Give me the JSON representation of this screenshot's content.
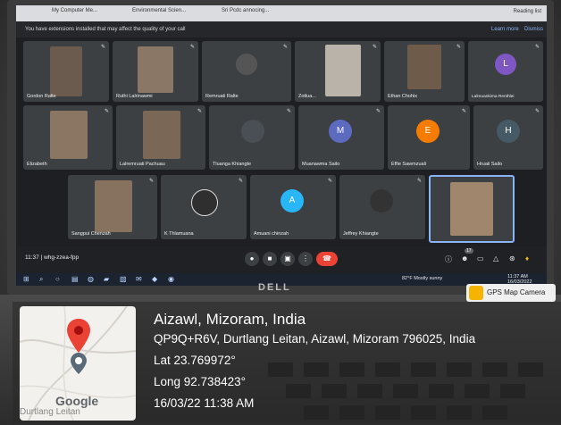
{
  "browser": {
    "tabs": [
      "My Computer Me...",
      "Environmental Scien...",
      "Sri Pcdc annocing..."
    ],
    "reading_list": "Reading list"
  },
  "banner": {
    "text": "You have extensions installed that may affect the quality of your call",
    "learn_more": "Learn more",
    "dismiss": "Dismiss"
  },
  "participants": [
    "Gordon Ralte",
    "Ruthi Lalrinawmi",
    "Remruati Ralte",
    "Zotlua...",
    "Ethan Chohix",
    "Lalmuankima Renthlei",
    "Elizabeth",
    "Lalremruati Pachuau",
    "Tluanga Khiangte",
    "Muanawma Sailo",
    "Effie Sawmzuali",
    "Hruaii Sailo",
    "Sangpui Chenzah",
    "K Thlamuana",
    "Amuani chinzah",
    "Jeffrey Khiangte"
  ],
  "avatars": {
    "lalmuankima": "L",
    "muanawma": "M",
    "effie": "E",
    "hruaii": "H",
    "amuani": "A"
  },
  "meeting": {
    "time_code": "11:37  |  whg-zzea-fpp",
    "participant_count": "17"
  },
  "taskbar": {
    "weather": "82°F  Mostly sunny",
    "clock_time": "11:37 AM",
    "clock_date": "16/03/2022"
  },
  "laptop_brand": "DELL",
  "gps": {
    "badge": "GPS Map Camera",
    "title": "Aizawl, Mizoram, India",
    "address": "QP9Q+R6V, Durtlang Leitan, Aizawl, Mizoram 796025, India",
    "lat": "Lat 23.769972°",
    "long": "Long 92.738423°",
    "datetime": "16/03/22 11:38 AM",
    "map_brand": "Google",
    "map_place": "Durtlang Leitan"
  },
  "colors": {
    "red": "#ea4335",
    "meet_bg": "#202124",
    "tile_bg": "#3c4043"
  }
}
